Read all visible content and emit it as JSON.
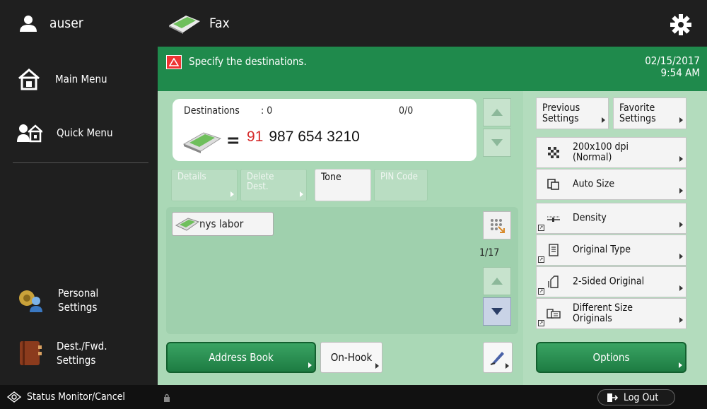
{
  "user": {
    "name": "auser"
  },
  "sidebar": {
    "items": [
      {
        "label": "Main Menu"
      },
      {
        "label": "Quick Menu"
      },
      {
        "label_line1": "Personal",
        "label_line2": "Settings"
      },
      {
        "label_line1": "Dest./Fwd.",
        "label_line2": "Settings"
      }
    ]
  },
  "header": {
    "title": "Fax"
  },
  "message": {
    "text": "Specify the destinations.",
    "date": "02/15/2017",
    "time": "9:54 AM"
  },
  "destination": {
    "label": "Destinations",
    "count": ": 0",
    "ratio": "0/0",
    "number_prefix": "91",
    "number": "987 654 3210"
  },
  "dest_buttons": {
    "details": "Details",
    "delete_line1": "Delete",
    "delete_line2": "Dest.",
    "tone": "Tone",
    "pin": "PIN Code"
  },
  "list": {
    "items": [
      {
        "label": "nys labor"
      }
    ],
    "page": "1/17"
  },
  "bottom": {
    "address_book": "Address Book",
    "on_hook": "On-Hook"
  },
  "right_panel": {
    "previous_line1": "Previous",
    "previous_line2": "Settings",
    "favorite_line1": "Favorite",
    "favorite_line2": "Settings",
    "resolution_line1": "200x100 dpi",
    "resolution_line2": "(Normal)",
    "size": "Auto Size",
    "density": "Density",
    "original_type": "Original Type",
    "two_sided": "2-Sided Original",
    "diff_size_line1": "Different Size",
    "diff_size_line2": "Originals",
    "options": "Options"
  },
  "status": {
    "monitor": "Status Monitor/Cancel",
    "logout": "Log Out"
  },
  "colors": {
    "accent_green": "#1f8a4c",
    "panel_green": "#aad8b6",
    "warning_red": "#e33333",
    "number_red": "#d62b2b"
  }
}
